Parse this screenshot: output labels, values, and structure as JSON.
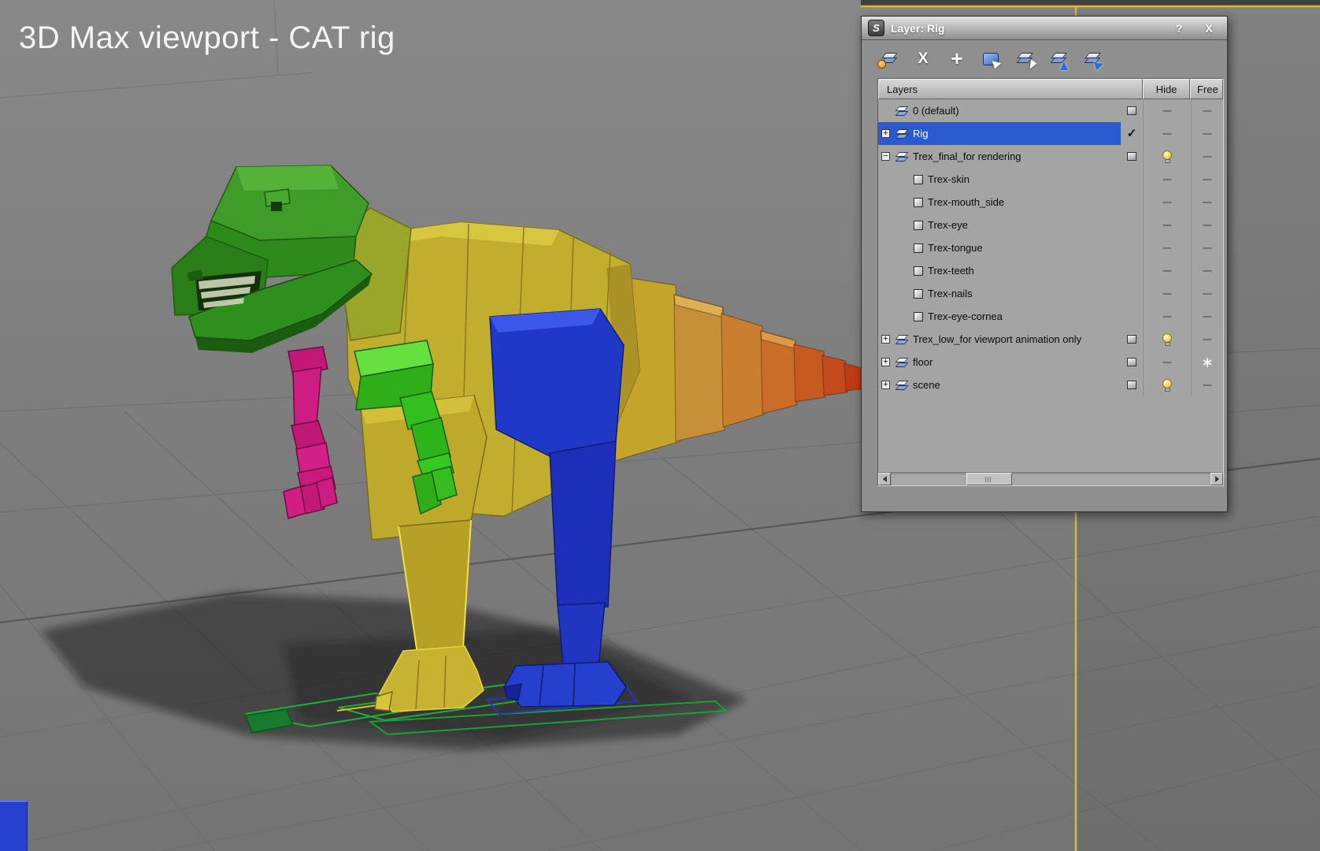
{
  "viewport": {
    "caption": "3D Max viewport - CAT rig",
    "border_color": "#d8bc2a"
  },
  "colors": {
    "selection_blue": "#2a5ad0",
    "rig_head_green": "#2f8a1c",
    "rig_body_yellow": "#c2ae2e",
    "rig_tail_red": "#c13a16",
    "rig_leg_blue": "#2038c8",
    "rig_arm_magenta": "#ce1d82",
    "rig_arm_green": "#33c01e"
  },
  "dialog": {
    "title": "Layer: Rig",
    "titlebar": {
      "help": "?",
      "close": "X"
    },
    "toolbar": [
      {
        "name": "create-new-layer",
        "icon": "new-layer-icon"
      },
      {
        "name": "delete-highlighted-empty-layers",
        "icon": "delete-x-icon"
      },
      {
        "name": "add-selection-to-highlighted-layer",
        "icon": "add-plus-icon"
      },
      {
        "name": "select-highlighted-objects-and-layers",
        "icon": "select-objects-icon"
      },
      {
        "name": "highlight-selected-objects-layers",
        "icon": "pick-layer-icon"
      },
      {
        "name": "hide-unhide-all-layers",
        "icon": "layers-up-arrow-icon"
      },
      {
        "name": "freeze-unfreeze-all-layers",
        "icon": "layers-run-icon"
      }
    ],
    "header": {
      "layers": "Layers",
      "hide": "Hide",
      "freeze": "Free"
    },
    "rows": [
      {
        "label": "0 (default)",
        "kind": "layer",
        "indent": 0,
        "expand": "none",
        "selected": false,
        "current": "box",
        "hide": "dash",
        "freeze": "dash"
      },
      {
        "label": "Rig",
        "kind": "layer",
        "indent": 0,
        "expand": "plus",
        "selected": true,
        "current": "check",
        "hide": "dash",
        "freeze": "dash"
      },
      {
        "label": "Trex_final_for rendering",
        "kind": "layer",
        "indent": 0,
        "expand": "minus",
        "selected": false,
        "current": "box",
        "hide": "bulb",
        "freeze": "dash"
      },
      {
        "label": "Trex-skin",
        "kind": "object",
        "indent": 1,
        "expand": "none",
        "selected": false,
        "current": "none",
        "hide": "dash",
        "freeze": "dash"
      },
      {
        "label": "Trex-mouth_side",
        "kind": "object",
        "indent": 1,
        "expand": "none",
        "selected": false,
        "current": "none",
        "hide": "dash",
        "freeze": "dash"
      },
      {
        "label": "Trex-eye",
        "kind": "object",
        "indent": 1,
        "expand": "none",
        "selected": false,
        "current": "none",
        "hide": "dash",
        "freeze": "dash"
      },
      {
        "label": "Trex-tongue",
        "kind": "object",
        "indent": 1,
        "expand": "none",
        "selected": false,
        "current": "none",
        "hide": "dash",
        "freeze": "dash"
      },
      {
        "label": "Trex-teeth",
        "kind": "object",
        "indent": 1,
        "expand": "none",
        "selected": false,
        "current": "none",
        "hide": "dash",
        "freeze": "dash"
      },
      {
        "label": "Trex-nails",
        "kind": "object",
        "indent": 1,
        "expand": "none",
        "selected": false,
        "current": "none",
        "hide": "dash",
        "freeze": "dash"
      },
      {
        "label": "Trex-eye-cornea",
        "kind": "object",
        "indent": 1,
        "expand": "none",
        "selected": false,
        "current": "none",
        "hide": "dash",
        "freeze": "dash"
      },
      {
        "label": "Trex_low_for viewport animation only",
        "kind": "layer",
        "indent": 0,
        "expand": "plus",
        "selected": false,
        "current": "box",
        "hide": "bulb",
        "freeze": "dash"
      },
      {
        "label": "floor",
        "kind": "layer",
        "indent": 0,
        "expand": "plus",
        "selected": false,
        "current": "box",
        "hide": "dash",
        "freeze": "flake"
      },
      {
        "label": "scene",
        "kind": "layer",
        "indent": 0,
        "expand": "plus",
        "selected": false,
        "current": "box",
        "hide": "bulb",
        "freeze": "dash"
      }
    ]
  }
}
